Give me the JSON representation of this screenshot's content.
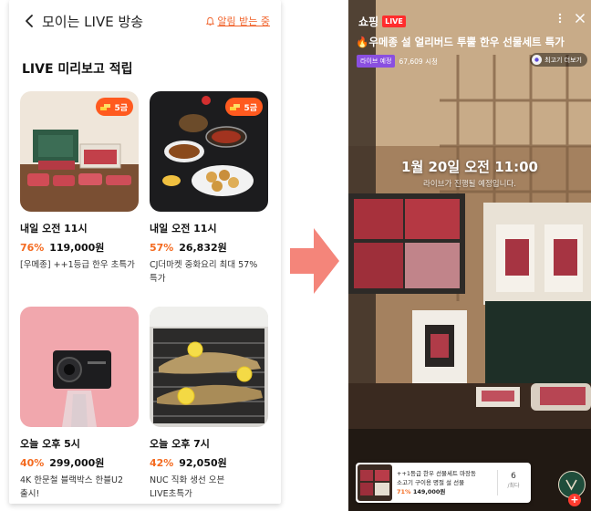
{
  "left": {
    "header": {
      "title": "모이는 LIVE 방송",
      "alarm_label": "알림 받는 중"
    },
    "section_title": "LIVE 미리보고 적립",
    "cards": [
      {
        "badge": "5금",
        "time": "내일 오전 11시",
        "discount": "76%",
        "price": "119,000원",
        "desc": "[우메종] ++1등급 한우 초특가"
      },
      {
        "badge": "5금",
        "time": "내일 오전 11시",
        "discount": "57%",
        "price": "26,832원",
        "desc": "CJ더마켓 중화요리 최대 57% 특가"
      },
      {
        "time": "오늘 오후 5시",
        "discount": "40%",
        "price": "299,000원",
        "desc": "4K 한문철 블랙박스 한블U2 출시!"
      },
      {
        "time": "오늘 오후 7시",
        "discount": "42%",
        "price": "92,050원",
        "desc": "NUC 직화 생선 오븐 LIVE초특가"
      }
    ]
  },
  "right": {
    "logo": "쇼핑",
    "live_badge": "LIVE",
    "title": "🔥우메종 설 얼리버드 투뿔 한우 선물세트 특가",
    "preview_badge": "라이브 예정",
    "views": "67,609 시청",
    "more_button": "최고기 더보기",
    "datetime": "1월 20일 오전 11:00",
    "subtitle": "라이브가 진행될 예정입니다.",
    "product": {
      "line1": "++1등급 한우 선물세트 마장동",
      "line2": "소고기 구이용 명절 설 선물",
      "discount": "71%",
      "price": "149,000원",
      "count": "6",
      "count_unit": "/최다"
    }
  },
  "colors": {
    "accent": "#f46a1f",
    "live_red": "#ff2d2d",
    "arrow": "#f4857a"
  }
}
